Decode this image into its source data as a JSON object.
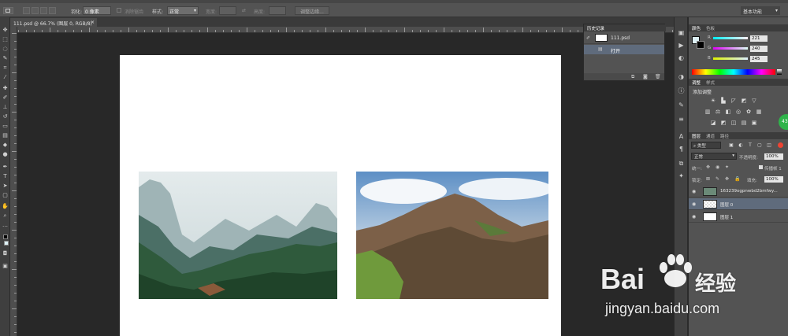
{
  "options_bar": {
    "feather_label": "羽化:",
    "feather_value": "0 像素",
    "antialias_label": "消除锯齿",
    "style_label": "样式:",
    "style_value": "正常",
    "width_label": "宽度:",
    "height_label": "高度:",
    "refine_edge_button": "调整边缘...",
    "workspace_value": "基本功能"
  },
  "document": {
    "tab_title": "111.psd @ 66.7% (图层 0, RGB/8)",
    "tab_close": "×"
  },
  "history_panel": {
    "tab": "历史记录",
    "snapshot_name": "111.psd",
    "states": [
      "打开"
    ]
  },
  "color_panel": {
    "tabs": [
      "颜色",
      "色板"
    ],
    "channels": [
      {
        "label": "R",
        "value": "221",
        "color": "#dd0000"
      },
      {
        "label": "G",
        "value": "240",
        "color": "#00cc00"
      },
      {
        "label": "B",
        "value": "245",
        "color": "#0000dd"
      }
    ],
    "foreground": "#ddf0f5"
  },
  "adjustments_panel": {
    "tabs": [
      "调整",
      "样式"
    ],
    "title": "添加调整"
  },
  "layers_panel": {
    "tabs": [
      "图层",
      "通道",
      "路径"
    ],
    "filter_kind": "类型",
    "blend_mode": "正常",
    "opacity_label": "不透明度:",
    "opacity_value": "100%",
    "unify_label": "统一:",
    "propagate_label": "传播帧 1",
    "lock_label": "锁定:",
    "fill_label": "填充:",
    "fill_value": "100%",
    "layers": [
      {
        "name": "163239ogpnwbd2bmfwy...",
        "selected": false
      },
      {
        "name": "图层 0",
        "selected": true
      },
      {
        "name": "图层 1",
        "selected": false
      }
    ]
  },
  "green_badge": "43",
  "watermark": {
    "brand": "Bai",
    "brand_cn": "经验",
    "url": "jingyan.baidu.com"
  }
}
